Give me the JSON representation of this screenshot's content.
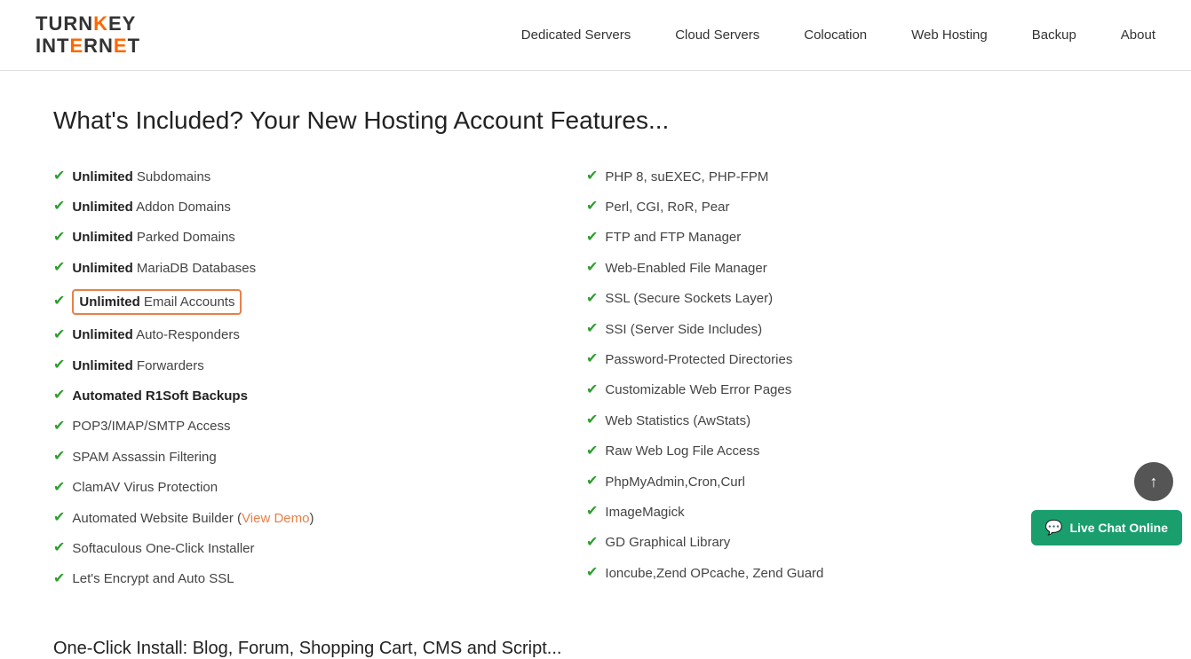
{
  "nav": {
    "logo_line1": "TURNKEY",
    "logo_line2": "INTERNET",
    "links": [
      {
        "label": "Dedicated Servers",
        "href": "#"
      },
      {
        "label": "Cloud Servers",
        "href": "#"
      },
      {
        "label": "Colocation",
        "href": "#"
      },
      {
        "label": "Web Hosting",
        "href": "#"
      },
      {
        "label": "Backup",
        "href": "#"
      },
      {
        "label": "About",
        "href": "#"
      }
    ]
  },
  "page": {
    "title": "What's Included? Your New Hosting Account Features..."
  },
  "features": {
    "left": [
      {
        "bold": "Unlimited",
        "rest": " Subdomains",
        "highlight": false
      },
      {
        "bold": "Unlimited",
        "rest": " Addon Domains",
        "highlight": false
      },
      {
        "bold": "Unlimited",
        "rest": " Parked Domains",
        "highlight": false
      },
      {
        "bold": "Unlimited",
        "rest": " MariaDB Databases",
        "highlight": false
      },
      {
        "bold": "Unlimited",
        "rest": " Email Accounts",
        "highlight": true
      },
      {
        "bold": "Unlimited",
        "rest": " Auto-Responders",
        "highlight": false
      },
      {
        "bold": "Unlimited",
        "rest": " Forwarders",
        "highlight": false
      },
      {
        "bold": "Automated R1Soft Backups",
        "rest": "",
        "highlight": false,
        "allbold": true
      },
      {
        "bold": "",
        "rest": "POP3/IMAP/SMTP Access",
        "highlight": false
      },
      {
        "bold": "",
        "rest": "SPAM Assassin Filtering",
        "highlight": false
      },
      {
        "bold": "",
        "rest": "ClamAV Virus Protection",
        "highlight": false
      },
      {
        "bold": "",
        "rest": "Automated Website Builder",
        "highlight": false,
        "viewdemo": true
      },
      {
        "bold": "",
        "rest": "Softaculous One-Click Installer",
        "highlight": false
      },
      {
        "bold": "",
        "rest": "Let's Encrypt and Auto SSL",
        "highlight": false
      }
    ],
    "right": [
      {
        "rest": "PHP 8, suEXEC, PHP-FPM"
      },
      {
        "rest": "Perl, CGI, RoR, Pear"
      },
      {
        "rest": "FTP and FTP Manager"
      },
      {
        "rest": "Web-Enabled File Manager"
      },
      {
        "rest": "SSL (Secure Sockets Layer)"
      },
      {
        "rest": "SSI (Server Side Includes)"
      },
      {
        "rest": "Password-Protected Directories"
      },
      {
        "rest": "Customizable Web Error Pages"
      },
      {
        "rest": "Web Statistics (AwStats)"
      },
      {
        "rest": "Raw Web Log File Access"
      },
      {
        "rest": "PhpMyAdmin,Cron,Curl"
      },
      {
        "rest": "ImageMagick"
      },
      {
        "rest": "GD Graphical Library"
      },
      {
        "rest": "Ioncube,Zend OPcache, Zend Guard"
      }
    ],
    "view_demo_label": "View Demo"
  },
  "scroll_btn": "↑",
  "live_chat": {
    "label": "Live Chat Online",
    "icon": "💬"
  },
  "bottom_peek": "One-Click Install: Blog, Forum, Shopping Cart, CMS and Script..."
}
